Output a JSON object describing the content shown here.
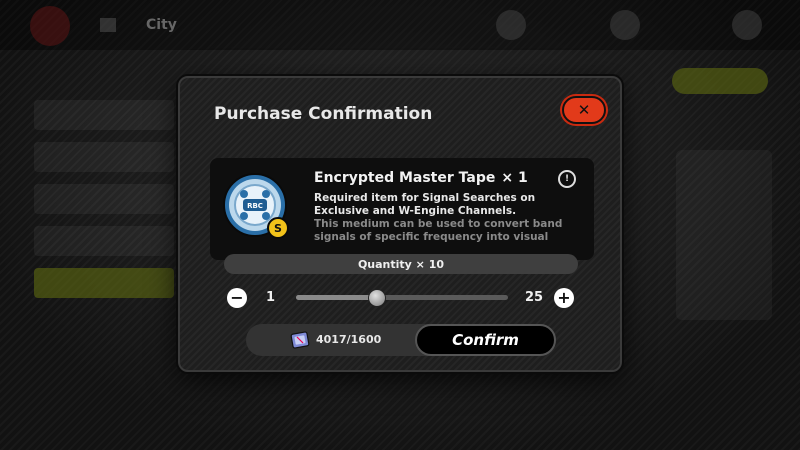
{
  "background": {
    "city_label": "City"
  },
  "dialog": {
    "title": "Purchase Confirmation",
    "close_icon": "close-x-icon"
  },
  "item": {
    "name": "Encrypted Master Tape",
    "count_label": "× 1",
    "icon": "master-tape-reel-icon",
    "description_main": "Required item for Signal Searches on Exclusive and W-Engine Channels.",
    "description_sub": "This medium can be used to convert band signals of specific frequency into visual"
  },
  "quantity": {
    "label": "Quantity × 10",
    "min": "1",
    "max": "25",
    "value": 10,
    "min_value": 1,
    "max_value": 25
  },
  "cost": {
    "currency_icon": "film-ticket-icon",
    "amount": "4017/1600"
  },
  "actions": {
    "confirm_label": "Confirm"
  },
  "colors": {
    "close_button": "#e23a1a",
    "accent_yellow": "#c8e01a"
  }
}
